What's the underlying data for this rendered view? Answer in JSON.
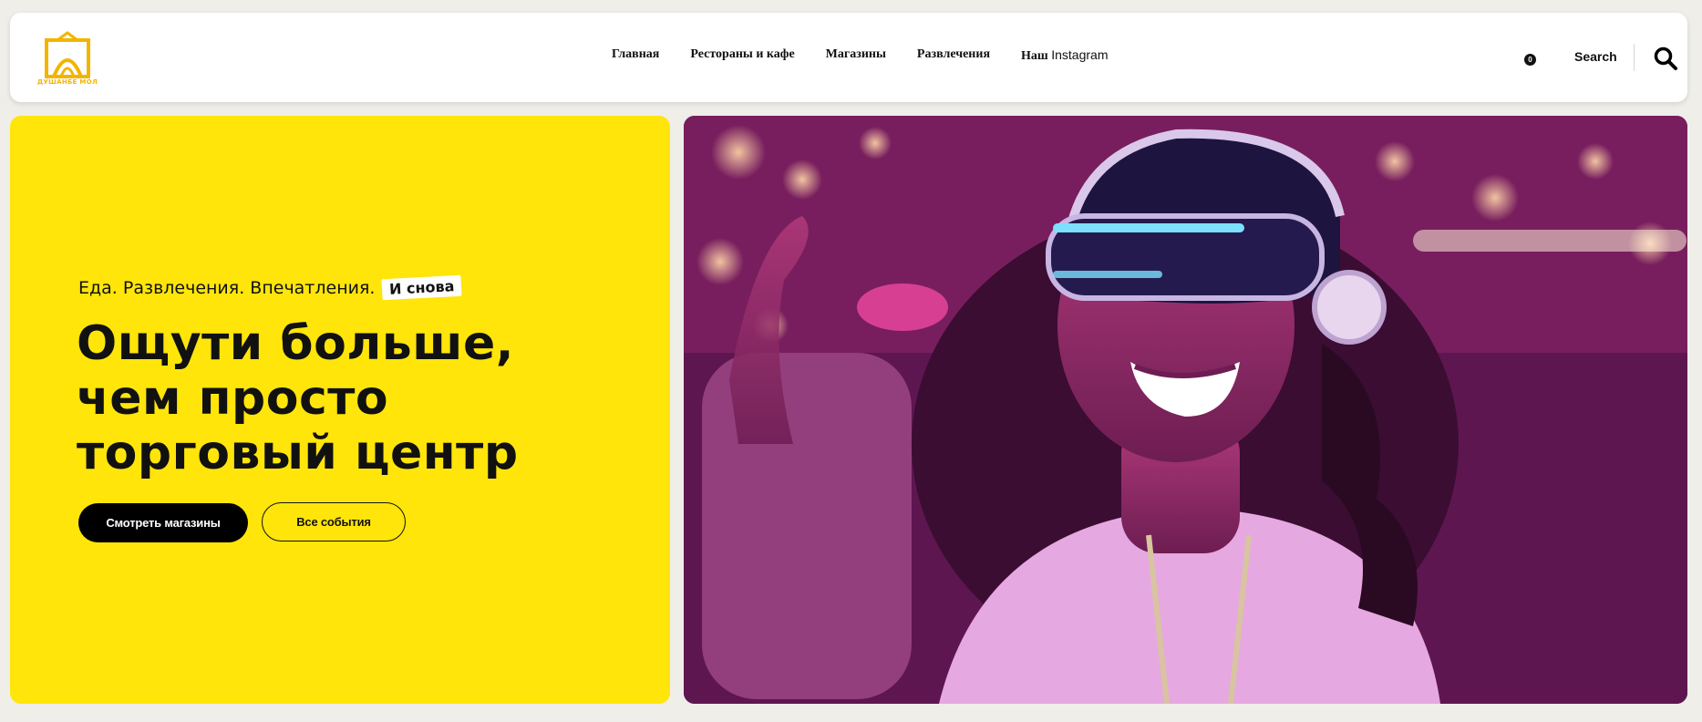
{
  "header": {
    "logo_text": "ДУШАНБЕ МОЛ",
    "nav": [
      {
        "label": "Главная"
      },
      {
        "label": "Рестораны и кафе"
      },
      {
        "label": "Магазины"
      },
      {
        "label": "Развлечения"
      },
      {
        "prefix": "Наш",
        "word": "Instagram"
      }
    ],
    "cart_count": "0",
    "search_label": "Search"
  },
  "hero": {
    "tagline": "Еда. Развлечения. Впечатления.",
    "tag_pill": "И снова",
    "headline_lines": [
      "Ощути больше,",
      "чем просто",
      "торговый центр"
    ],
    "primary_button": "Смотреть магазины",
    "secondary_button": "Все события"
  },
  "colors": {
    "accent_yellow": "#ffe50a",
    "logo_orange": "#f3b400",
    "page_bg": "#efeee9"
  },
  "icons": {
    "logo": "shopping-bag-logo-icon",
    "search": "magnifier-icon"
  }
}
